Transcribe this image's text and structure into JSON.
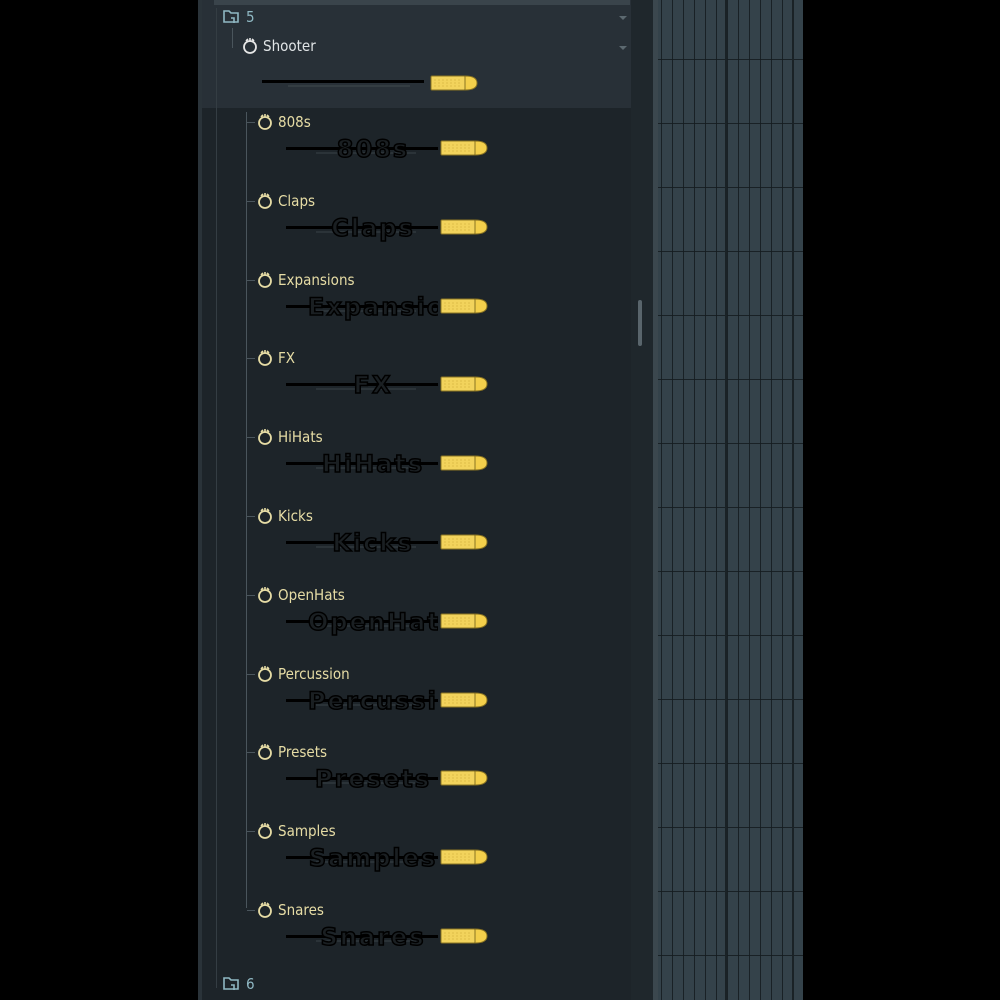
{
  "browser": {
    "folder_top": {
      "label": "5",
      "icon": "folder-icon"
    },
    "folder_bottom": {
      "label": "6",
      "icon": "folder-icon"
    },
    "pack": {
      "label": "Shooter",
      "icon": "pack-icon",
      "banner_text": ""
    },
    "items": [
      {
        "label": "808s",
        "banner_text": "808s"
      },
      {
        "label": "Claps",
        "banner_text": "Claps"
      },
      {
        "label": "Expansions",
        "banner_text": "Expansions"
      },
      {
        "label": "FX",
        "banner_text": "FX"
      },
      {
        "label": "HiHats",
        "banner_text": "HiHats"
      },
      {
        "label": "Kicks",
        "banner_text": "Kicks"
      },
      {
        "label": "OpenHats",
        "banner_text": "OpenHats"
      },
      {
        "label": "Percussion",
        "banner_text": "Percussion"
      },
      {
        "label": "Presets",
        "banner_text": "Presets"
      },
      {
        "label": "Samples",
        "banner_text": "Samples"
      },
      {
        "label": "Snares",
        "banner_text": "Snares"
      }
    ]
  },
  "colors": {
    "folder_text": "#8fb8c3",
    "item_text": "#e6dca5",
    "bullet": "#f2d35c",
    "panel_bg": "#1d2429",
    "grid_bg": "#34424a"
  }
}
